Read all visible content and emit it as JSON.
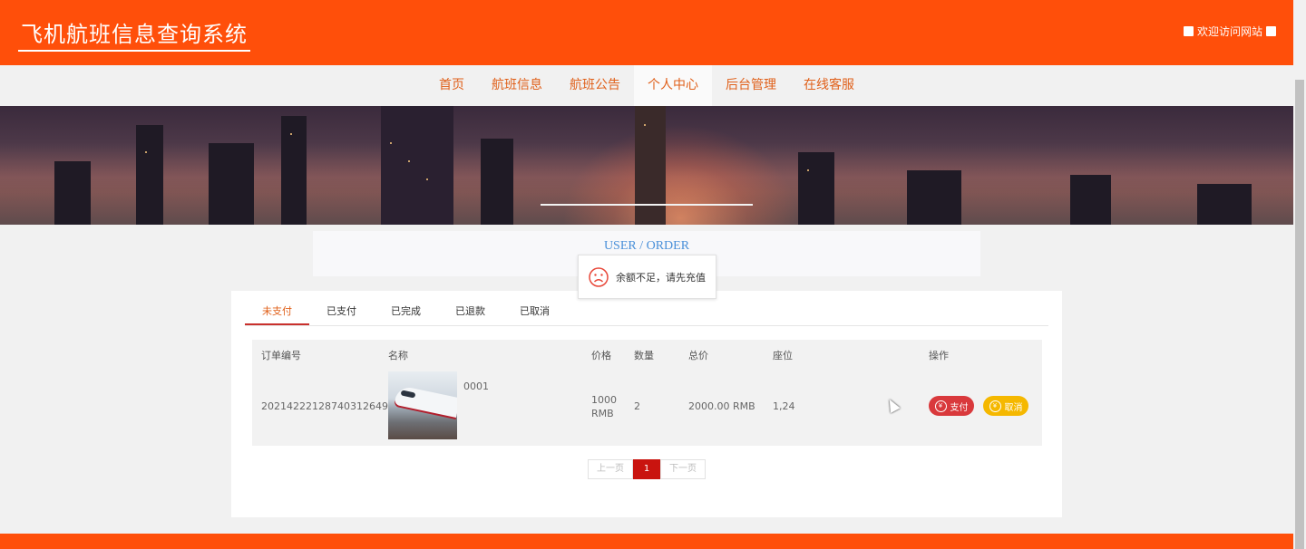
{
  "header": {
    "site_title": "飞机航班信息查询系统",
    "welcome_text": "欢迎访问网站"
  },
  "nav": {
    "items": [
      {
        "label": "首页"
      },
      {
        "label": "航班信息"
      },
      {
        "label": "航班公告"
      },
      {
        "label": "个人中心"
      },
      {
        "label": "后台管理"
      },
      {
        "label": "在线客服"
      }
    ],
    "active_index": 3
  },
  "page": {
    "section_title": "USER / ORDER"
  },
  "toast": {
    "message": "余额不足，请先充值",
    "icon": "sad-face-icon"
  },
  "tabs": [
    {
      "label": "未支付"
    },
    {
      "label": "已支付"
    },
    {
      "label": "已完成"
    },
    {
      "label": "已退款"
    },
    {
      "label": "已取消"
    }
  ],
  "table": {
    "headers": {
      "order_no": "订单编号",
      "name": "名称",
      "price": "价格",
      "qty": "数量",
      "total": "总价",
      "seat": "座位",
      "action": "操作"
    },
    "rows": [
      {
        "order_no": "20214222128740312649",
        "name": "0001",
        "price_line1": "1000",
        "price_line2": "RMB",
        "qty": "2",
        "total": "2000.00 RMB",
        "seat": "1,24",
        "pay_label": "支付",
        "cancel_label": "取消"
      }
    ]
  },
  "pager": {
    "prev": "上一页",
    "current": "1",
    "next": "下一页"
  },
  "colors": {
    "brand": "#ff4f0a",
    "pay_button": "#d9393c",
    "cancel_button": "#f5b800",
    "accent_blue": "#4a90d9"
  }
}
